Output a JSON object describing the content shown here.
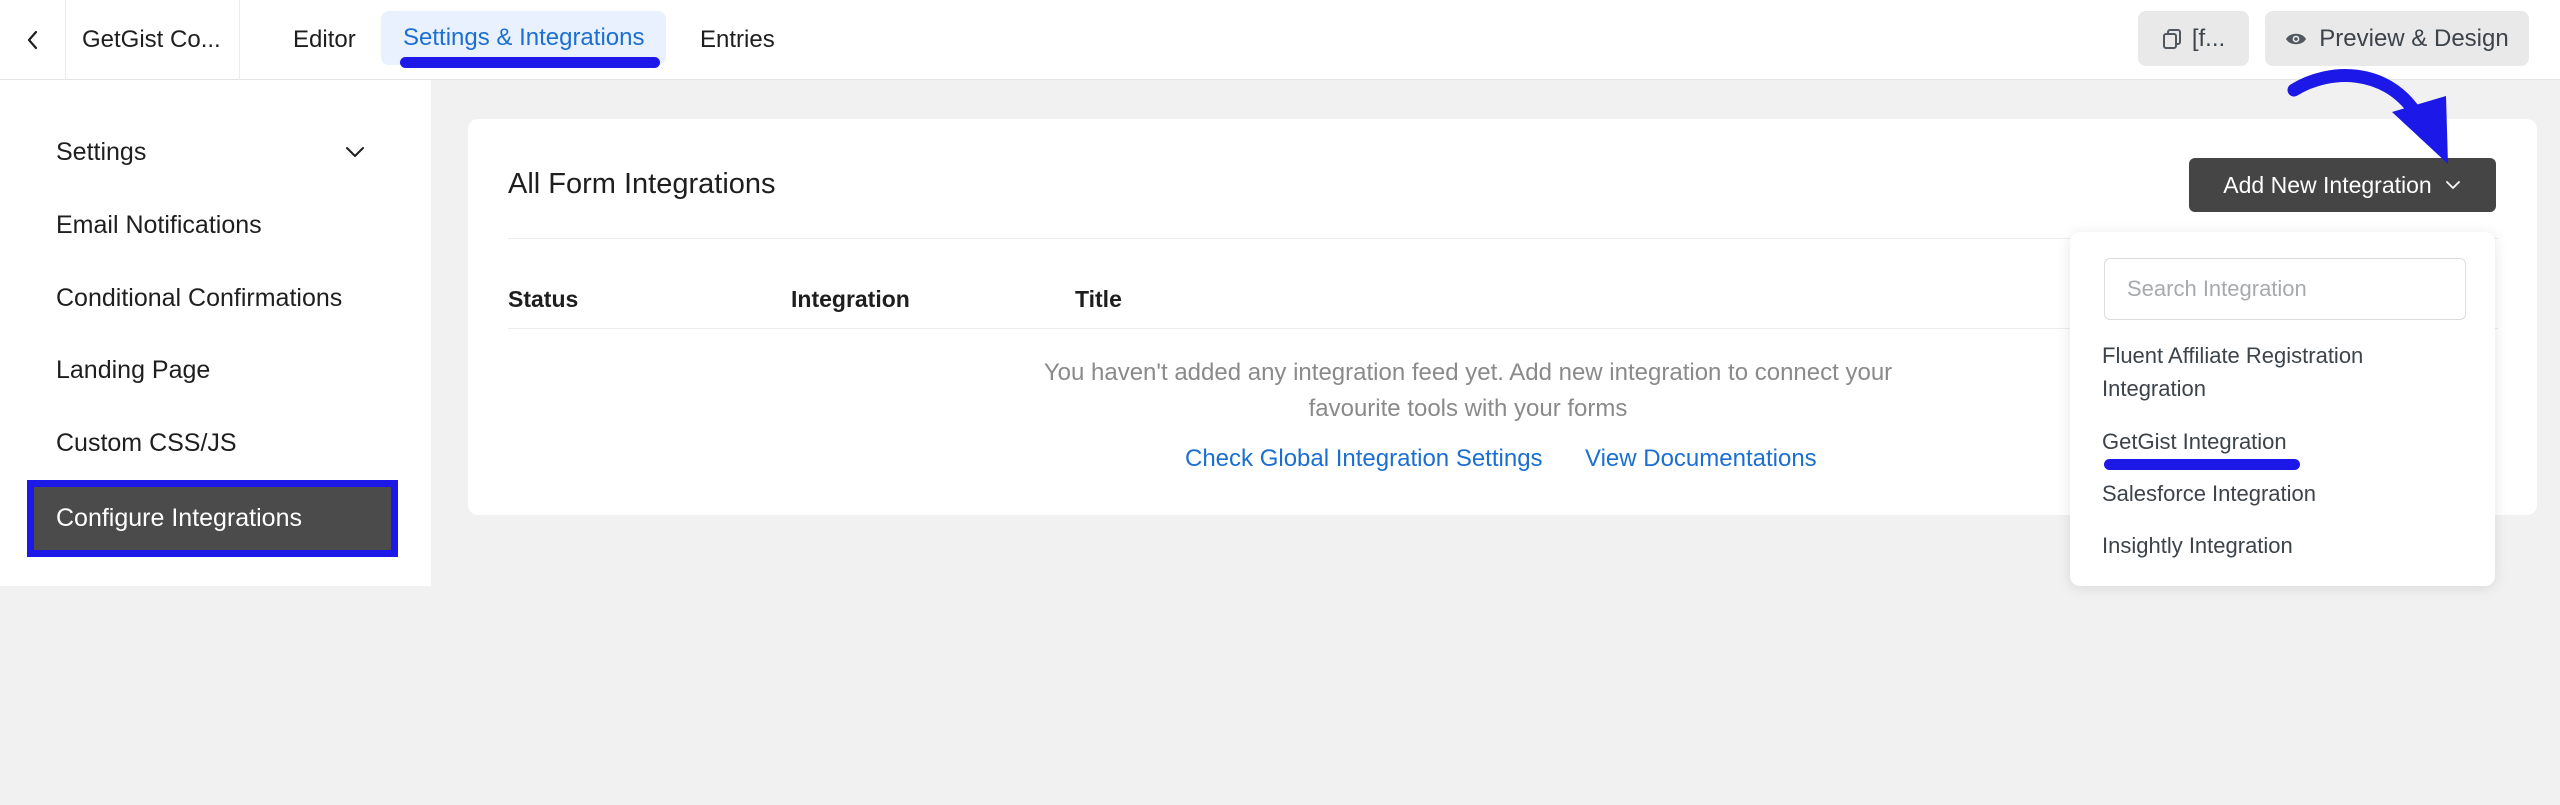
{
  "header": {
    "form_name": "GetGist Co...",
    "tabs": [
      {
        "label": "Editor",
        "active": false
      },
      {
        "label": "Settings & Integrations",
        "active": true
      },
      {
        "label": "Entries",
        "active": false
      }
    ],
    "shortcode_label": "[f...",
    "preview_label": "Preview & Design"
  },
  "sidebar": {
    "items": [
      {
        "label": "Settings",
        "has_chevron": true
      },
      {
        "label": "Email Notifications"
      },
      {
        "label": "Conditional Confirmations"
      },
      {
        "label": "Landing Page"
      },
      {
        "label": "Custom CSS/JS"
      },
      {
        "label": "Configure Integrations",
        "active": true
      }
    ]
  },
  "main": {
    "title": "All Form Integrations",
    "add_button_label": "Add New Integration",
    "columns": [
      "Status",
      "Integration",
      "Title"
    ],
    "empty_message": "You haven't added any integration feed yet. Add new integration to connect your favourite tools with your forms",
    "links": [
      "Check Global Integration Settings",
      "View Documentations"
    ]
  },
  "dropdown": {
    "search_placeholder": "Search Integration",
    "search_value": "",
    "items": [
      "Fluent Affiliate Registration Integration",
      "GetGist Integration",
      "Salesforce Integration",
      "Insightly Integration"
    ]
  },
  "colors": {
    "accent": "#1b6fd1",
    "annotation": "#1c19e8",
    "active_bg": "#4b4b4b",
    "button_dark": "#454545",
    "tab_active_bg": "#e8f1fd"
  },
  "icons": [
    "chevron-left-icon",
    "copy-icon",
    "eye-icon",
    "chevron-down-icon",
    "curved-arrow-annotation"
  ]
}
